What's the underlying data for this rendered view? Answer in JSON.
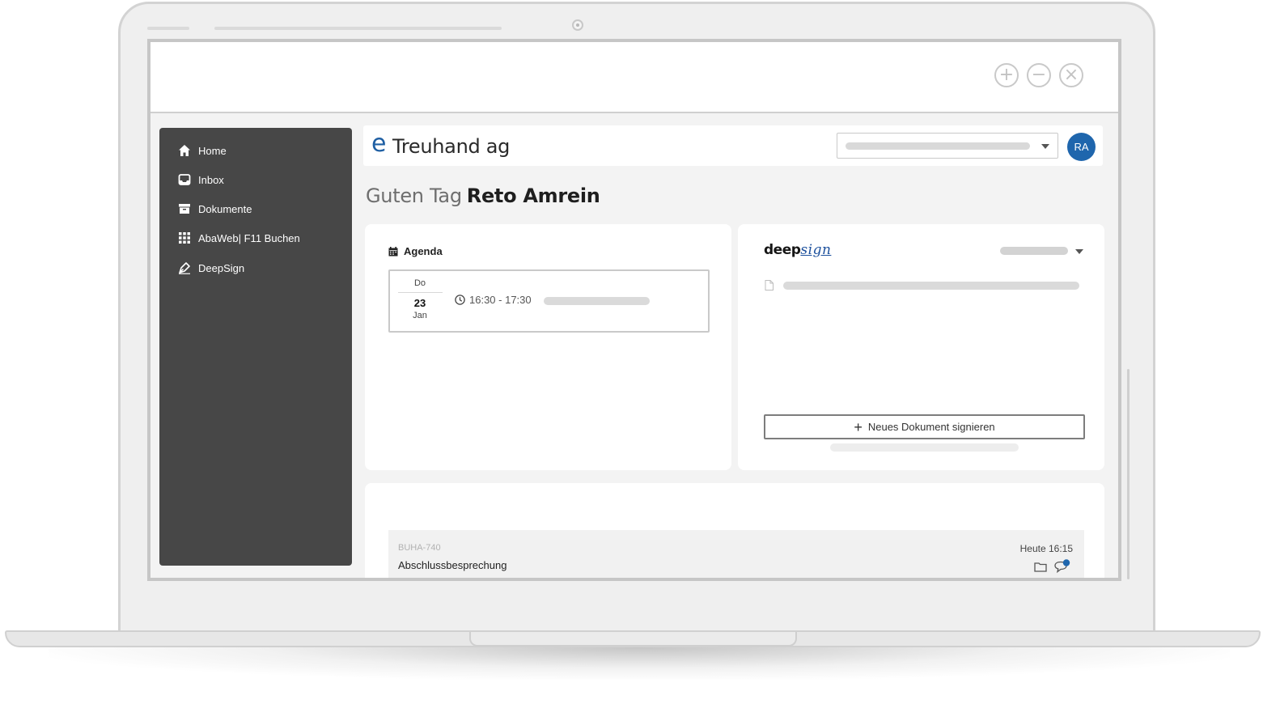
{
  "window": {
    "buttons": [
      {
        "name": "maximize",
        "glyph": "+"
      },
      {
        "name": "minimize",
        "glyph": "−"
      },
      {
        "name": "close",
        "glyph": "×"
      }
    ]
  },
  "sidebar": {
    "items": [
      {
        "label": "Home",
        "icon": "home-icon"
      },
      {
        "label": "Inbox",
        "icon": "inbox-icon"
      },
      {
        "label": "Dokumente",
        "icon": "archive-icon"
      },
      {
        "label": "AbaWeb| F11 Buchen",
        "icon": "grid-icon"
      },
      {
        "label": "DeepSign",
        "icon": "pen-icon"
      }
    ]
  },
  "header": {
    "logo_mark": "e",
    "logo_text": "Treuhand ag",
    "avatar_initials": "RA"
  },
  "greeting": {
    "prefix": "Guten Tag",
    "name": "Reto Amrein"
  },
  "agenda": {
    "title": "Agenda",
    "entries": [
      {
        "weekday": "Do",
        "day": "23",
        "month": "Jan",
        "time": "16:30 - 17:30"
      }
    ]
  },
  "deepsign": {
    "logo_prefix": "deep",
    "logo_script": "sign",
    "button_icon": "+",
    "button_label": "Neues Dokument signieren"
  },
  "tasks": [
    {
      "id": "BUHA-740",
      "title": "Abschlussbesprechung",
      "date": "Heute 16:15"
    }
  ],
  "colors": {
    "accent": "#1f66ad",
    "sidebar_bg": "#474747",
    "page_bg": "#f3f3f3"
  }
}
